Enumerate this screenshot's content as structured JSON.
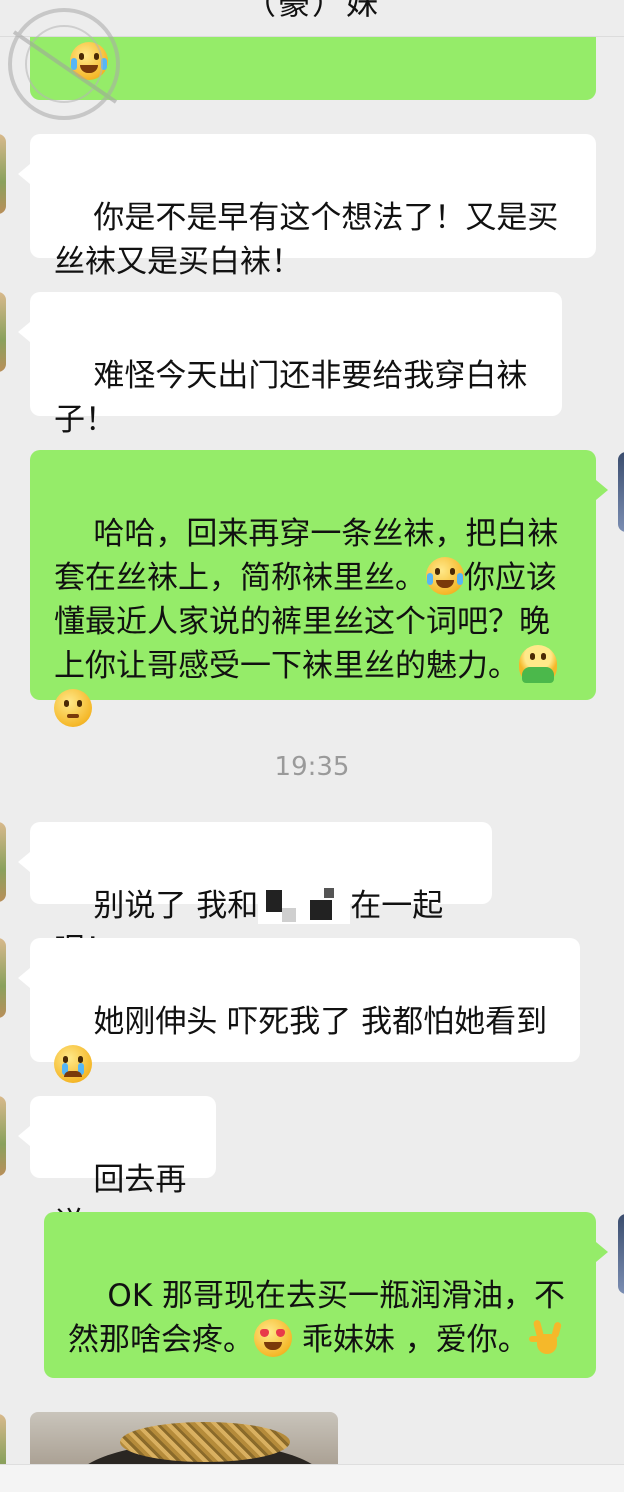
{
  "header": {
    "title": "（豪）妹"
  },
  "messages": {
    "m1": {
      "text": "你是不是早有这个想法了！又是买丝袜又是买白袜！"
    },
    "m2": {
      "text": "难怪今天出门还非要给我穿白袜子！"
    },
    "m3": {
      "part1": "哈哈，回来再穿一条丝袜，把白袜套在丝袜上，简称袜里丝。",
      "part2": "你应该懂最近人家说的裤里丝这个词吧？晚上你让哥感受一下袜里丝的魅力。"
    },
    "timestamp": "19:35",
    "m4": {
      "part1": "别说了 我和",
      "part2": "在一起呢！"
    },
    "m5": {
      "text": "她刚伸头 吓死我了 我都怕她看到"
    },
    "m6": {
      "text": "回去再说"
    },
    "m7": {
      "part1": "OK 那哥现在去买一瓶润滑油，不然那啥会疼。",
      "part2": " 乖妹妹 ，爱你。"
    }
  },
  "icons": {
    "watermark": "watermark-stamp-icon",
    "emoji_laugh_cry": "laughing-crying-emoji-icon",
    "emoji_hug": "hug-emoji-icon",
    "emoji_thinking": "thinking-emoji-icon",
    "emoji_crying": "crying-emoji-icon",
    "emoji_heart_eyes": "heart-eyes-emoji-icon",
    "hand_rock": "rock-hand-emoji-icon"
  },
  "colors": {
    "background": "#ededed",
    "incoming_bubble": "#ffffff",
    "outgoing_bubble": "#95ec69",
    "timestamp": "#9a9a9a"
  }
}
